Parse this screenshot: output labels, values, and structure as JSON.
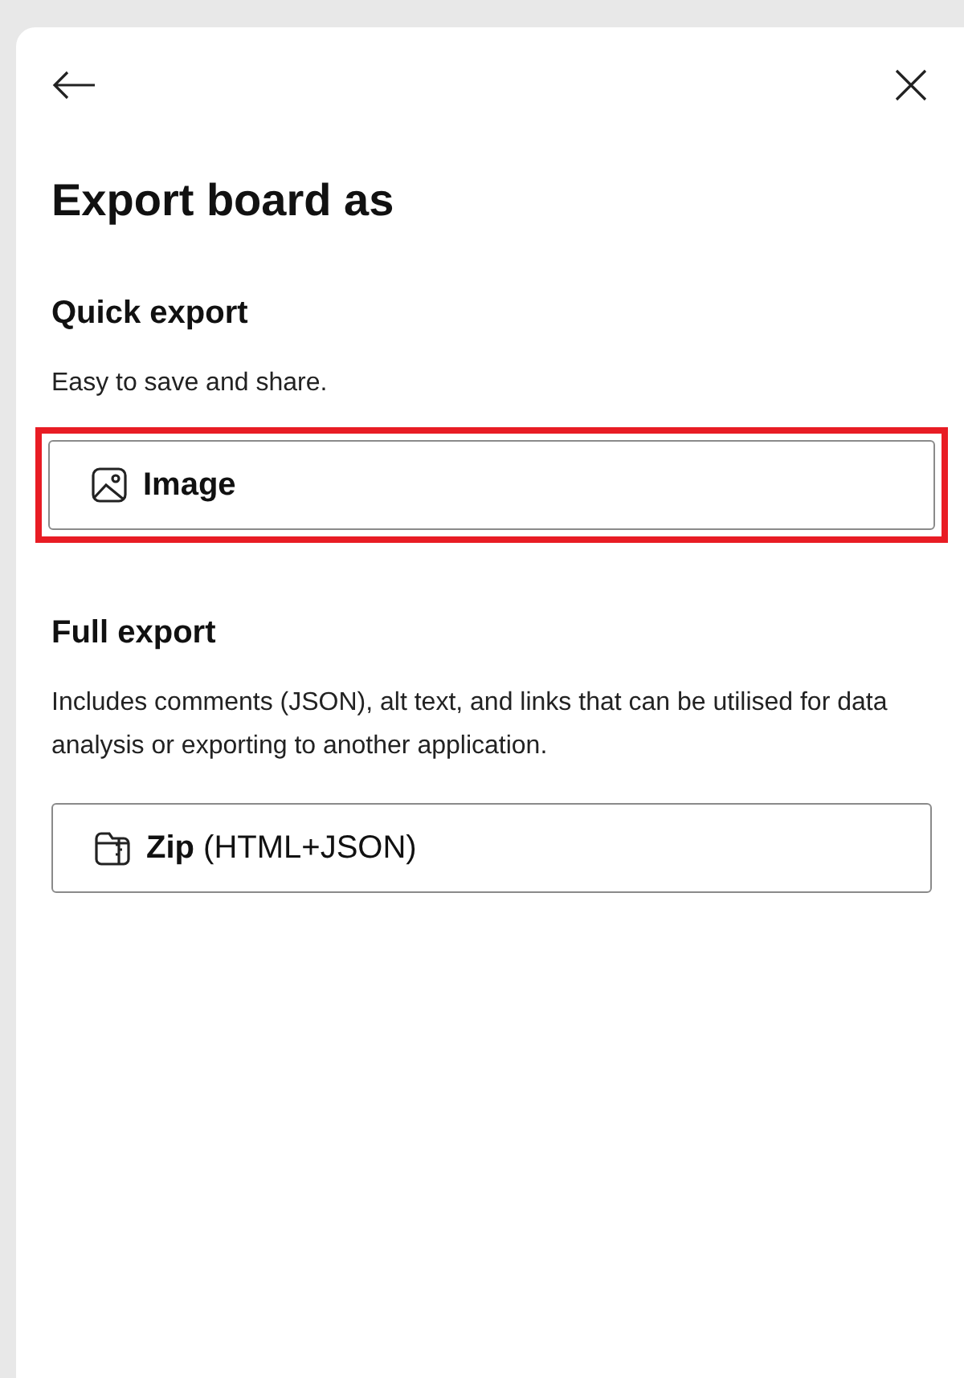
{
  "panel": {
    "title": "Export board as",
    "sections": [
      {
        "heading": "Quick export",
        "description": "Easy to save and share.",
        "button": {
          "kind": "image",
          "label": "**Image**",
          "highlighted": true
        }
      },
      {
        "heading": "Full export",
        "description": "Includes comments (JSON), alt text, and links that can be utilised for data analysis or exporting to another application.",
        "button": {
          "kind": "zip",
          "label": "**Zip** (HTML+JSON)",
          "highlighted": false
        }
      }
    ]
  }
}
